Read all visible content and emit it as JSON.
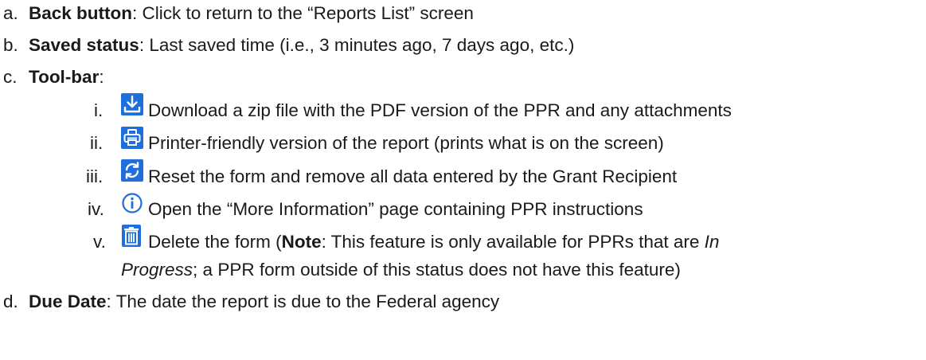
{
  "items": [
    {
      "marker": "a.",
      "term": "Back button",
      "text": ": Click to return to the “Reports List” screen"
    },
    {
      "marker": "b.",
      "term": "Saved status",
      "text": ": Last saved time (i.e., 3 minutes ago, 7 days ago, etc.)"
    },
    {
      "marker": "c.",
      "term": "Tool-bar",
      "text": ":"
    },
    {
      "marker": "d.",
      "term": "Due Date",
      "text": ": The date the report is due to the Federal agency"
    }
  ],
  "toolbar": [
    {
      "marker": "i.",
      "icon": "download-icon",
      "text": "Download a zip file with the PDF version of the PPR and any attachments"
    },
    {
      "marker": "ii.",
      "icon": "printer-icon",
      "text": "Printer-friendly version of the report (prints what is on the screen)"
    },
    {
      "marker": "iii.",
      "icon": "reset-icon",
      "text": "Reset the form and remove all data entered by the Grant Recipient"
    },
    {
      "marker": "iv.",
      "icon": "info-icon",
      "text": "Open the “More Information” page containing PPR instructions"
    },
    {
      "marker": "v.",
      "icon": "trash-icon",
      "text_before": "Delete the form (",
      "note_label": "Note",
      "text_mid": ": This feature is only available for PPRs that are ",
      "status_italic": "In",
      "continuation_italic": "Progress",
      "continuation_text": "; a PPR form outside of this status does not have this feature)"
    }
  ],
  "icon_color": "#1e6fdc"
}
